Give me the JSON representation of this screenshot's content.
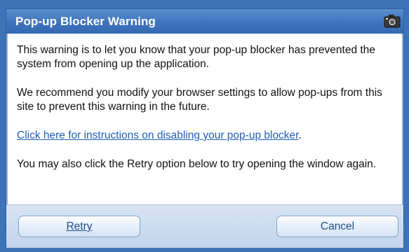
{
  "dialog": {
    "title": "Pop-up Blocker Warning",
    "title_icon": "camera-icon",
    "paragraph1": "This warning is to let you know that your pop-up blocker has prevented the system from opening up the application.",
    "paragraph2": "We recommend you modify your browser settings to allow pop-ups from this site to prevent this warning in the future.",
    "instructions_link": "Click here for instructions on disabling your pop-up blocker",
    "instructions_suffix": ".",
    "paragraph4": "You may also click the Retry option below to try opening the window again."
  },
  "buttons": {
    "retry_label": "Retry",
    "cancel_label": "Cancel"
  },
  "colors": {
    "titlebar": "#3f74bd",
    "link": "#1f5fb8",
    "footer": "#c3d5ec"
  }
}
